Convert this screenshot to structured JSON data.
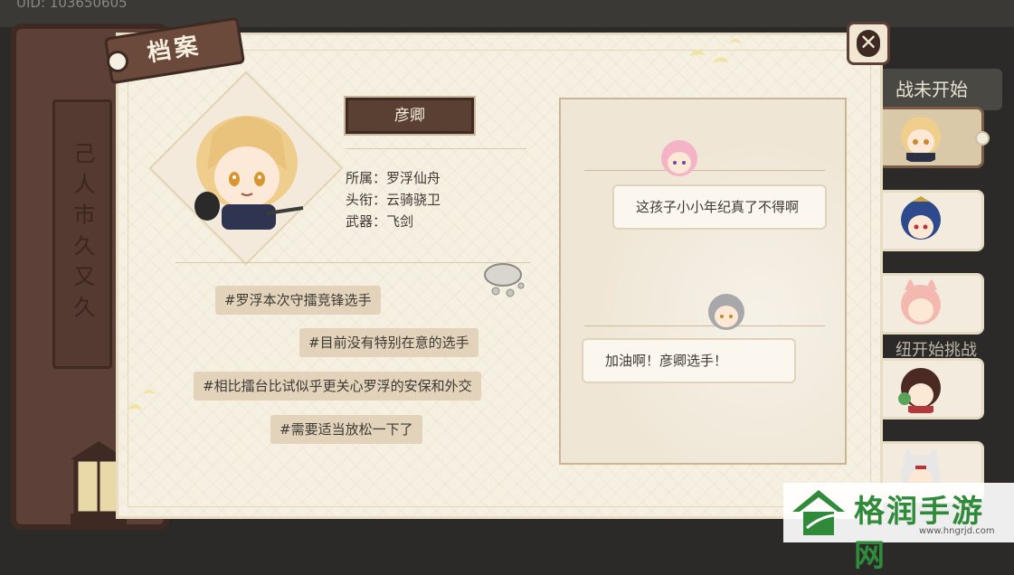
{
  "top": {
    "uid": "UID: 103650605"
  },
  "window": {
    "tab_label": "档案",
    "close_icon": "close-icon"
  },
  "profile": {
    "name": "彦卿",
    "attributes": [
      {
        "label": "所属：",
        "value": "罗浮仙舟"
      },
      {
        "label": "头衔：",
        "value": "云骑骁卫"
      },
      {
        "label": "武器：",
        "value": "飞剑"
      }
    ],
    "tags": [
      "#罗浮本次守擂竞锋选手",
      "#目前没有特别在意的选手",
      "#相比擂台比试似乎更关心罗浮的安保和外交",
      "#需要适当放松一下了"
    ]
  },
  "dialog": {
    "messages": [
      {
        "text": "这孩子小小年纪真了不得啊"
      },
      {
        "text": "加油啊！彦卿选手！"
      }
    ]
  },
  "sidebar": {
    "status_top": "战未开始",
    "status_mid": "纽开始挑战",
    "spine_glyphs": "己人市久又久"
  },
  "watermark": {
    "text": "格润手游网",
    "url": "www.hngrjd.com"
  },
  "colors": {
    "accent_brown": "#5d4037",
    "paper": "#f6f0e2",
    "tag_bg": "#e2d3ba",
    "watermark_green": "#2f8a3a"
  }
}
